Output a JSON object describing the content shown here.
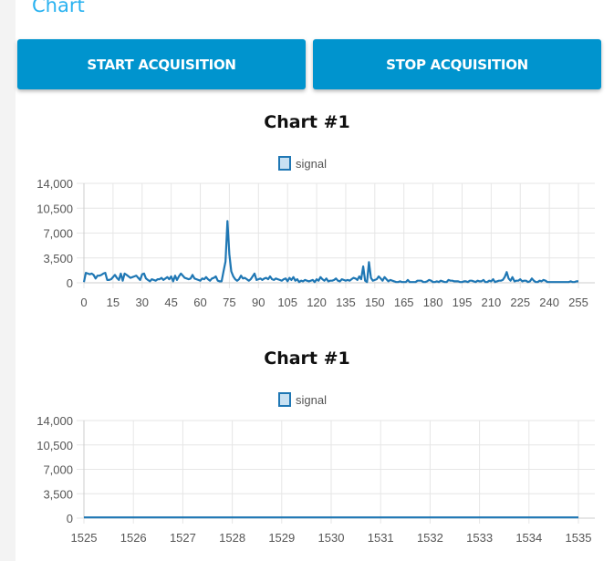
{
  "page_title": "Chart",
  "buttons": {
    "start": "START ACQUISITION",
    "stop": "STOP ACQUISITION"
  },
  "colors": {
    "accent": "#0094ce",
    "series": "#1f77b4",
    "legend_fill": "#c9e1f2"
  },
  "chart_data": [
    {
      "type": "line",
      "title": "Chart #1",
      "legend": [
        "signal"
      ],
      "legend_placement": "top",
      "ylim": [
        0,
        14000
      ],
      "y_ticks": [
        "14,000",
        "10,500",
        "7,000",
        "3,500",
        "0"
      ],
      "y_tick_values": [
        14000,
        10500,
        7000,
        3500,
        0
      ],
      "xlim": [
        0,
        255
      ],
      "x_ticks": [
        "0",
        "15",
        "30",
        "45",
        "60",
        "75",
        "90",
        "105",
        "120",
        "135",
        "150",
        "165",
        "180",
        "195",
        "210",
        "225",
        "240",
        "255"
      ],
      "grid": true,
      "series": [
        {
          "name": "signal",
          "values": [
            100,
            1400,
            1300,
            1200,
            1300,
            1100,
            600,
            1000,
            1000,
            1100,
            1300,
            1400,
            400,
            400,
            500,
            800,
            1100,
            700,
            400,
            1300,
            300,
            1300,
            1100,
            900,
            700,
            800,
            900,
            1000,
            700,
            400,
            1200,
            1300,
            600,
            400,
            200,
            500,
            400,
            300,
            500,
            500,
            700,
            400,
            600,
            800,
            500,
            900,
            200,
            1000,
            400,
            900,
            1300,
            1000,
            700,
            600,
            500,
            600,
            1100,
            600,
            500,
            400,
            300,
            600,
            500,
            800,
            500,
            300,
            600,
            700,
            900,
            300,
            200,
            200,
            1600,
            3000,
            8700,
            4000,
            1600,
            900,
            500,
            300,
            500,
            1000,
            600,
            700,
            500,
            300,
            500,
            900,
            1300,
            400,
            500,
            600,
            400,
            600,
            700,
            500,
            900,
            500,
            400,
            600,
            500,
            400,
            300,
            500,
            600,
            200,
            700,
            400,
            800,
            300,
            500,
            100,
            300,
            200,
            400,
            300,
            200,
            300,
            400,
            100,
            500,
            300,
            800,
            500,
            300,
            600,
            200,
            300,
            300,
            400,
            600,
            300,
            200,
            500,
            400,
            300,
            400,
            300,
            500,
            700,
            600,
            400,
            900,
            500,
            2300,
            300,
            100,
            2900,
            700,
            300,
            400,
            500,
            900,
            600,
            300,
            800,
            500,
            200,
            400,
            300,
            200,
            100,
            100,
            200,
            100,
            100,
            100,
            400,
            100,
            100,
            100,
            100,
            300,
            300,
            300,
            100,
            100,
            200,
            400,
            300,
            100,
            100,
            200,
            100,
            300,
            200,
            100,
            100,
            400,
            300,
            300,
            200,
            200,
            200,
            100,
            100,
            200,
            200,
            100,
            300,
            300,
            200,
            100,
            300,
            200,
            200,
            400,
            100,
            100,
            300,
            200,
            500,
            100,
            200,
            300,
            300,
            400,
            800,
            1500,
            600,
            300,
            800,
            200,
            300,
            300,
            500,
            200,
            300,
            300,
            100,
            200,
            600,
            300,
            100,
            100,
            300,
            200,
            400,
            300,
            100,
            100,
            100,
            100,
            100,
            100,
            100,
            100,
            100,
            100,
            100,
            100,
            200,
            100,
            100,
            200,
            200
          ]
        }
      ]
    },
    {
      "type": "line",
      "title": "Chart #1",
      "legend": [
        "signal"
      ],
      "legend_placement": "top",
      "ylim": [
        0,
        14000
      ],
      "y_ticks": [
        "14,000",
        "10,500",
        "7,000",
        "3,500",
        "0"
      ],
      "y_tick_values": [
        14000,
        10500,
        7000,
        3500,
        0
      ],
      "xlim": [
        1525,
        1535
      ],
      "x_ticks": [
        "1525",
        "1526",
        "1527",
        "1528",
        "1529",
        "1530",
        "1531",
        "1532",
        "1533",
        "1534",
        "1535"
      ],
      "grid": true,
      "series": [
        {
          "name": "signal",
          "x": [
            1525,
            1526,
            1527,
            1528,
            1529,
            1530,
            1531,
            1532,
            1533,
            1534,
            1535
          ],
          "values": [
            100,
            100,
            100,
            100,
            100,
            100,
            100,
            100,
            100,
            100,
            100
          ]
        }
      ]
    }
  ]
}
